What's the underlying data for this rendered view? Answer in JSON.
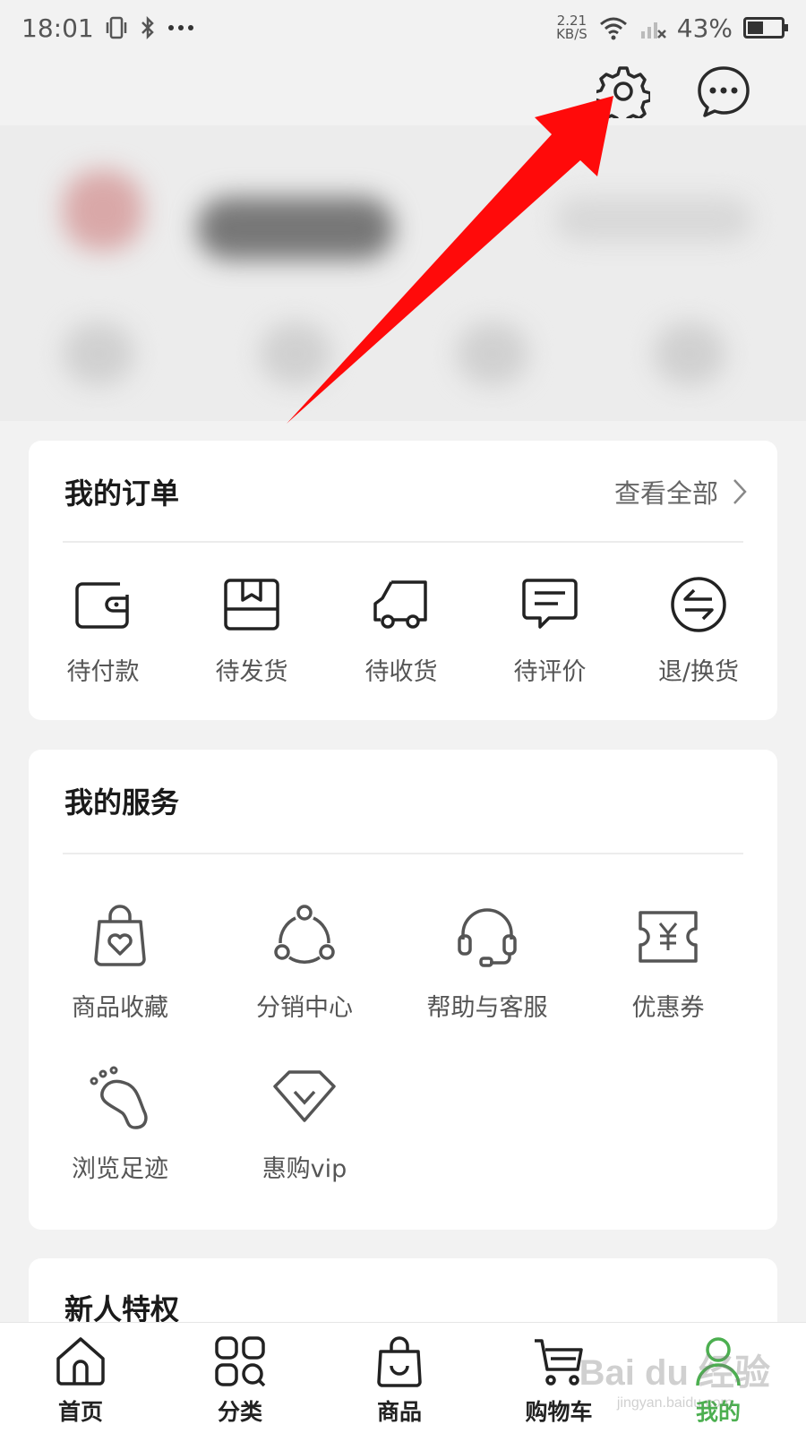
{
  "status_bar": {
    "time": "18:01",
    "net_speed_value": "2.21",
    "net_speed_unit": "KB/S",
    "battery": "43%",
    "battery_level": 0.43
  },
  "header": {
    "settings_icon": "gear-icon",
    "message_icon": "chat-bubble-icon",
    "annotation_color": "#ff0000"
  },
  "orders": {
    "title": "我的订单",
    "view_all": "查看全部",
    "items": [
      {
        "label": "待付款",
        "icon": "wallet-icon"
      },
      {
        "label": "待发货",
        "icon": "package-icon"
      },
      {
        "label": "待收货",
        "icon": "truck-icon"
      },
      {
        "label": "待评价",
        "icon": "comment-icon"
      },
      {
        "label": "退/换货",
        "icon": "exchange-icon"
      }
    ]
  },
  "services": {
    "title": "我的服务",
    "items": [
      {
        "label": "商品收藏",
        "icon": "favorite-bag-icon"
      },
      {
        "label": "分销中心",
        "icon": "share-network-icon"
      },
      {
        "label": "帮助与客服",
        "icon": "headset-icon"
      },
      {
        "label": "优惠券",
        "icon": "coupon-icon"
      },
      {
        "label": "浏览足迹",
        "icon": "footprint-icon"
      },
      {
        "label": "惠购vip",
        "icon": "diamond-icon"
      }
    ]
  },
  "newcomer": {
    "title": "新人特权"
  },
  "bottom_nav": {
    "items": [
      {
        "label": "首页",
        "icon": "home-icon"
      },
      {
        "label": "分类",
        "icon": "category-icon"
      },
      {
        "label": "商品",
        "icon": "shopping-bag-icon"
      },
      {
        "label": "购物车",
        "icon": "cart-icon"
      },
      {
        "label": "我的",
        "icon": "user-icon"
      }
    ],
    "active_color": "#4caf50"
  },
  "watermark": {
    "line1": "Bai du 经验",
    "line2": "jingyan.baidu.com"
  }
}
